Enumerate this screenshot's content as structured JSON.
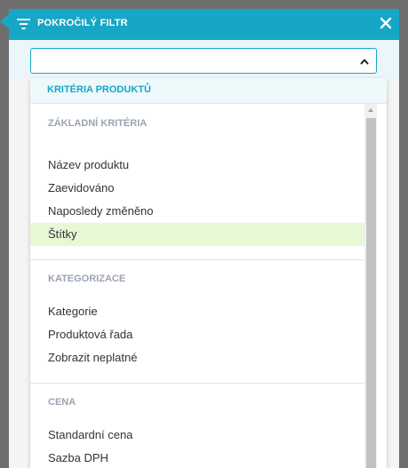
{
  "header": {
    "title": "POKROČILÝ FILTR",
    "filter_icon": "filter-icon",
    "close_icon": "close-icon",
    "accent_color": "#17a6c6"
  },
  "select": {
    "value": "",
    "toggle_icon": "chevron-up-icon"
  },
  "dropdown": {
    "header_label": "KRITÉRIA PRODUKTŮ",
    "groups": [
      {
        "label": "ZÁKLADNÍ KRITÉRIA",
        "items": [
          "Název produktu",
          "Zaevidováno",
          "Naposledy změněno",
          "Štítky"
        ]
      },
      {
        "label": "KATEGORIZACE",
        "items": [
          "Kategorie",
          "Produktová řada",
          "Zobrazit neplatné"
        ]
      },
      {
        "label": "CENA",
        "items": [
          "Standardní cena",
          "Sazba DPH"
        ]
      }
    ],
    "selected_item": "Štítky",
    "selected_color": "#e6f8d6"
  }
}
